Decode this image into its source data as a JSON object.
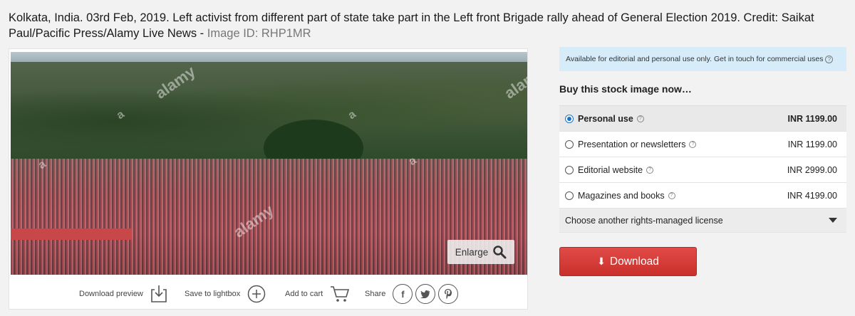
{
  "caption": {
    "text": "Kolkata, India. 03rd Feb, 2019. Left activist from different part of state take part in the Left front Brigade rally ahead of General Election 2019. Credit: Saikat Paul/Pacific Press/Alamy Live News -",
    "image_id": "Image ID: RHP1MR"
  },
  "photo": {
    "watermark": "alamy",
    "watermark_small": "a",
    "enlarge_label": "Enlarge"
  },
  "actions": {
    "download_preview": "Download preview",
    "save_to_lightbox": "Save to lightbox",
    "add_to_cart": "Add to cart",
    "share": "Share",
    "share_icons": [
      "facebook-icon",
      "twitter-icon",
      "pinterest-icon"
    ]
  },
  "panel": {
    "notice": "Available for editorial and personal use only. Get in touch for commercial uses",
    "buy_title": "Buy this stock image now…",
    "licenses": [
      {
        "label": "Personal use",
        "price": "INR 1199.00",
        "selected": true
      },
      {
        "label": "Presentation or newsletters",
        "price": "INR 1199.00",
        "selected": false
      },
      {
        "label": "Editorial website",
        "price": "INR 2999.00",
        "selected": false
      },
      {
        "label": "Magazines and books",
        "price": "INR 4199.00",
        "selected": false
      }
    ],
    "other_license": "Choose another rights-managed license",
    "download_label": "Download"
  },
  "colors": {
    "accent_blue": "#1a73c8",
    "download_red": "#d63b37",
    "notice_bg": "#d7ecf9"
  }
}
